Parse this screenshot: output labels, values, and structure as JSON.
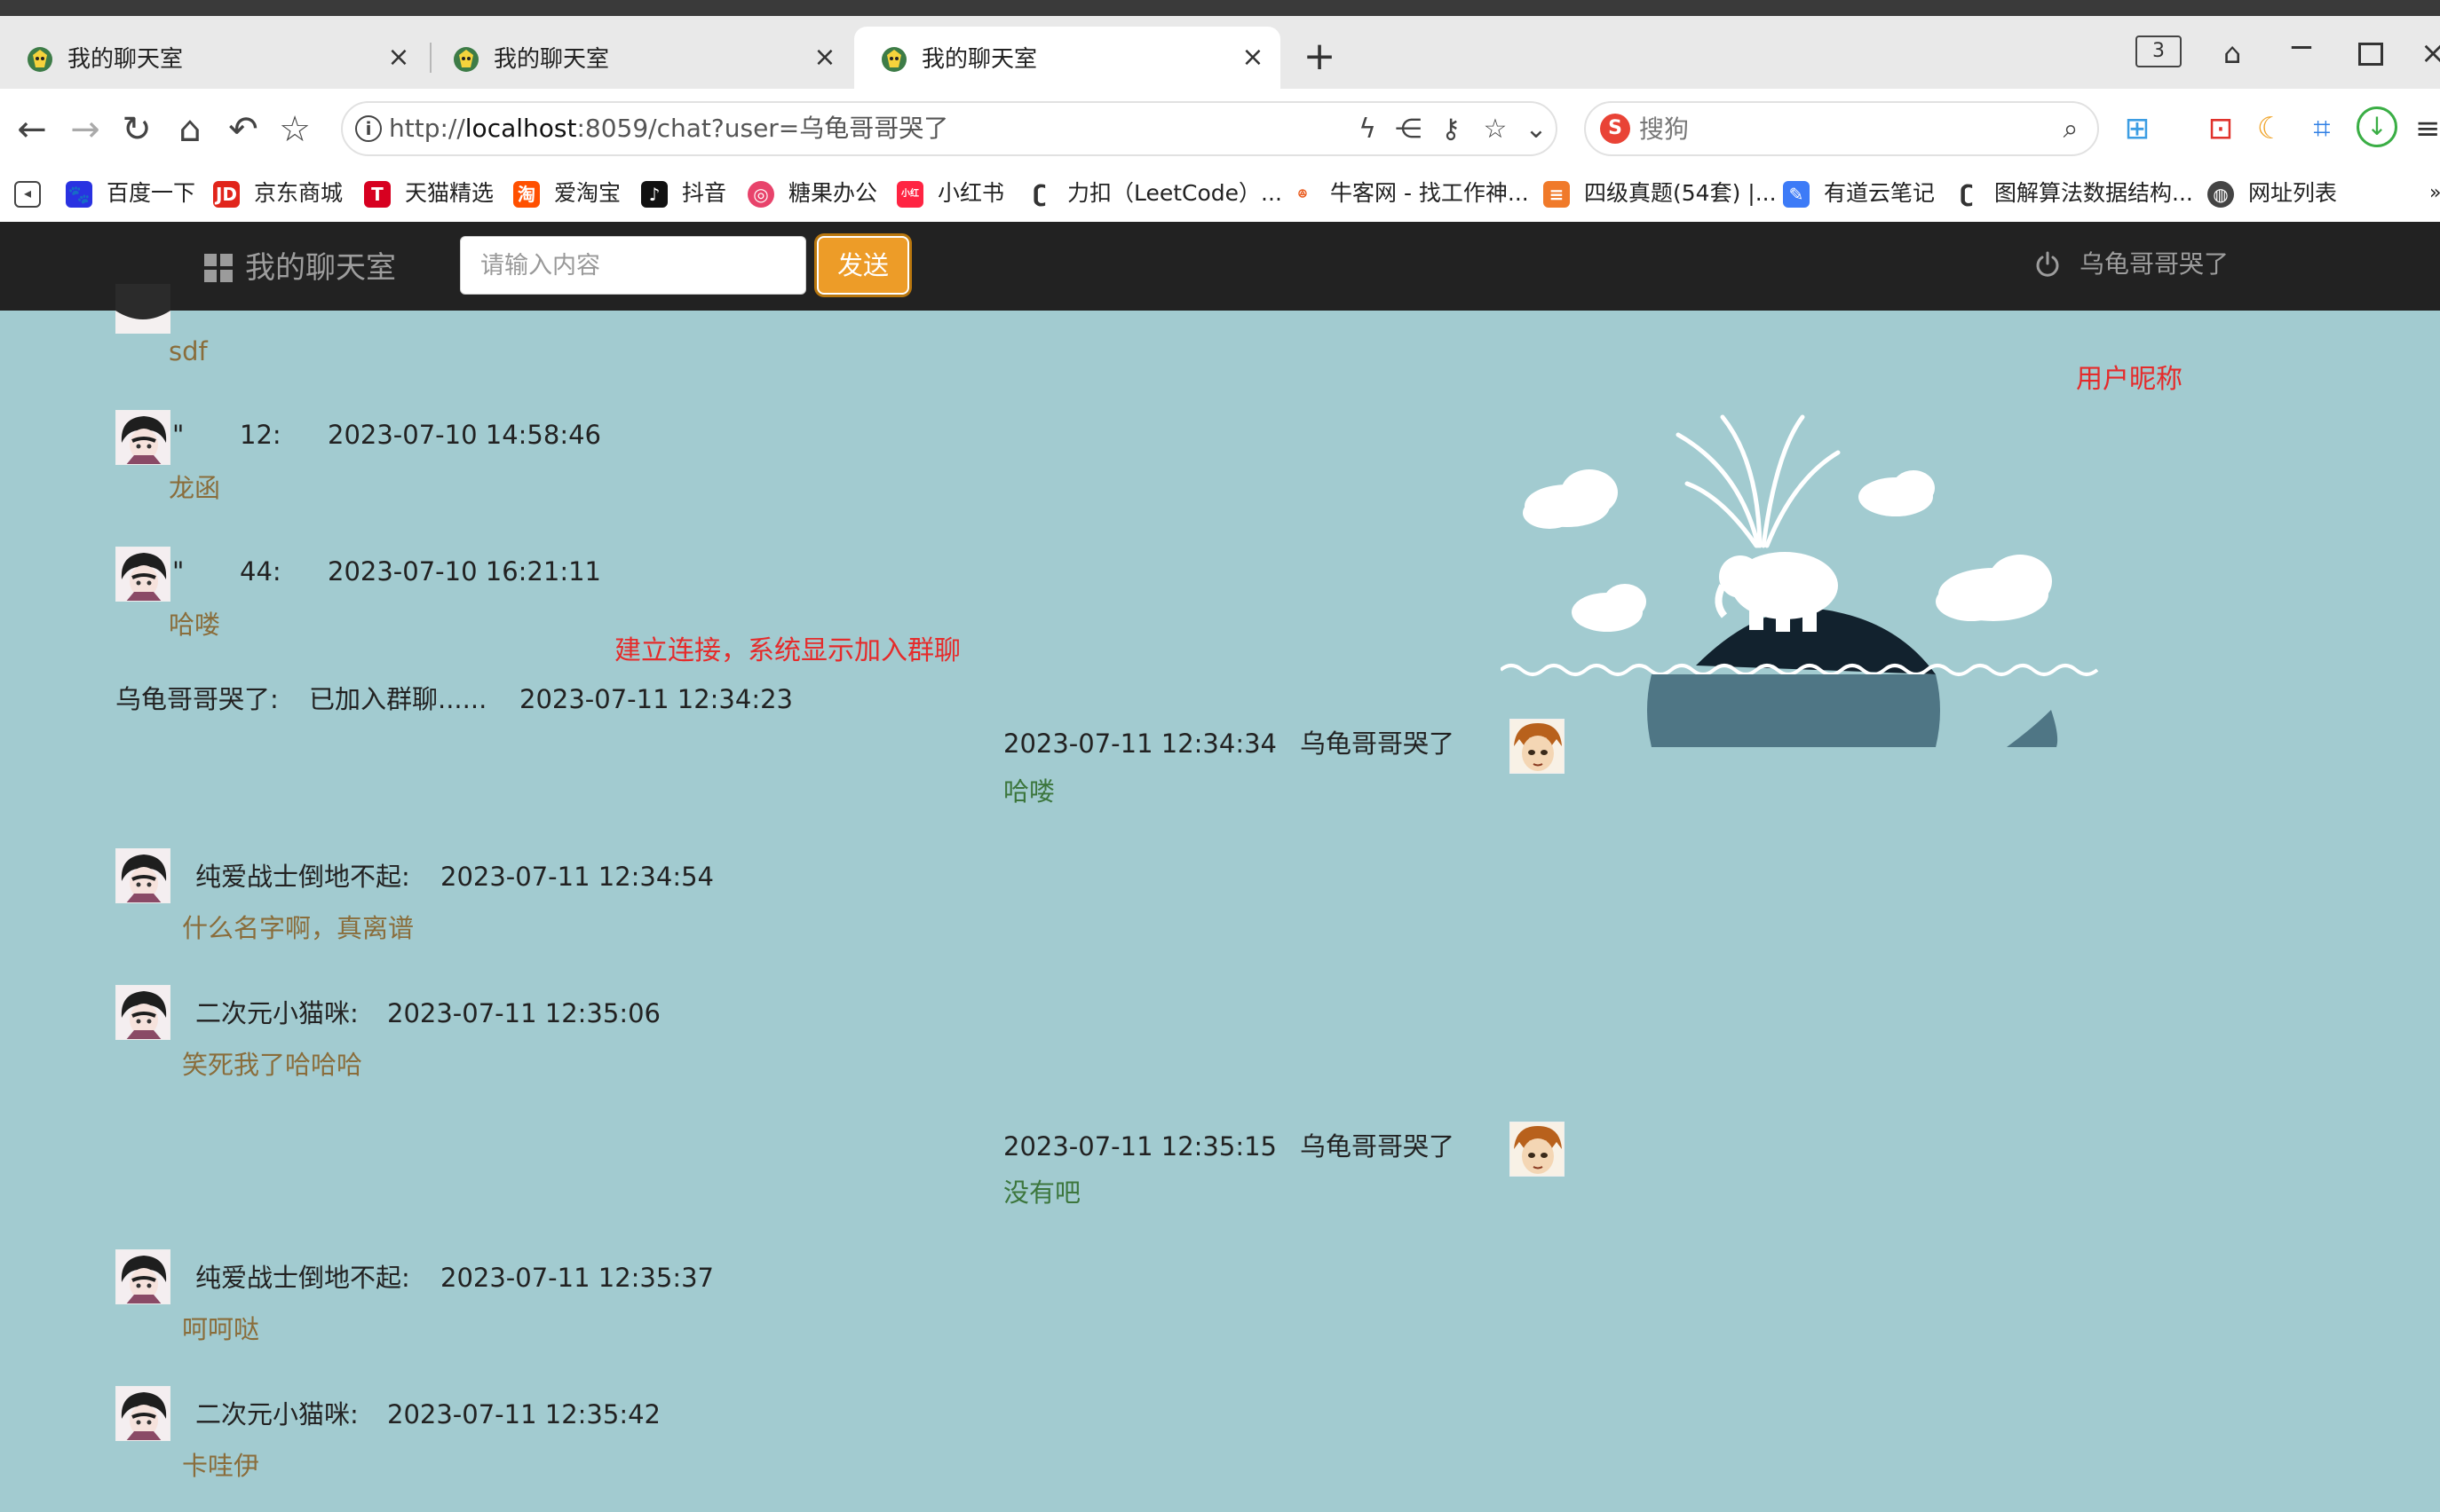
{
  "browser": {
    "tabs": [
      {
        "title": "我的聊天室"
      },
      {
        "title": "我的聊天室"
      },
      {
        "title": "我的聊天室"
      }
    ],
    "tab_count": "3",
    "url_prefix": "http://",
    "url_host": "localhost",
    "url_rest": ":8059/chat?user=乌龟哥哥哭了",
    "search_placeholder": "搜狗",
    "bookmarks": [
      {
        "label": "百度一下",
        "icon": "baidu-icon",
        "color": "#2932e1"
      },
      {
        "label": "京东商城",
        "icon": "jd-icon",
        "color": "#e1251b"
      },
      {
        "label": "天猫精选",
        "icon": "tmall-icon",
        "color": "#d70020"
      },
      {
        "label": "爱淘宝",
        "icon": "taobao-icon",
        "color": "#ff5000"
      },
      {
        "label": "抖音",
        "icon": "douyin-icon",
        "color": "#111111"
      },
      {
        "label": "糖果办公",
        "icon": "tangguo-icon",
        "color": "#e8436b"
      },
      {
        "label": "小红书",
        "icon": "xiaohongshu-icon",
        "color": "#ff2442"
      },
      {
        "label": "力扣（LeetCode）...",
        "icon": "leetcode-icon",
        "color": "#f89f1b"
      },
      {
        "label": "牛客网 - 找工作神...",
        "icon": "nowcoder-icon",
        "color": "#e95a1c"
      },
      {
        "label": "四级真题(54套) |...",
        "icon": "doc-icon",
        "color": "#f07a2a"
      },
      {
        "label": "有道云笔记",
        "icon": "youdao-icon",
        "color": "#3d7bf7"
      },
      {
        "label": "图解算法数据结构...",
        "icon": "leetcode-icon",
        "color": "#f89f1b"
      },
      {
        "label": "网址列表",
        "icon": "globe-icon",
        "color": "#444444"
      }
    ]
  },
  "app": {
    "brand": "我的聊天室",
    "input_placeholder": "请输入内容",
    "send_label": "发送",
    "current_user": "乌龟哥哥哭了"
  },
  "chat": {
    "partial_top": {
      "text": "sdf"
    },
    "entries": [
      {
        "who": "\"",
        "name_rest": "12:",
        "time": "2023-07-10 14:58:46",
        "text": "龙函"
      },
      {
        "who": "\"",
        "name_rest": "44:",
        "time": "2023-07-10 16:21:11",
        "text": "哈喽"
      }
    ],
    "system": {
      "name": "乌龟哥哥哭了:",
      "text": "已加入群聊......",
      "time": "2023-07-11 12:34:23"
    },
    "mine": [
      {
        "time": "2023-07-11 12:34:34",
        "name": "乌龟哥哥哭了",
        "text": "哈喽"
      },
      {
        "time": "2023-07-11 12:35:15",
        "name": "乌龟哥哥哭了",
        "text": "没有吧"
      }
    ],
    "others": [
      {
        "name": "纯爱战士倒地不起:",
        "time": "2023-07-11 12:34:54",
        "text": "什么名字啊，真离谱"
      },
      {
        "name": "二次元小猫咪:",
        "time": "2023-07-11 12:35:06",
        "text": "笑死我了哈哈哈"
      },
      {
        "name": "纯爱战士倒地不起:",
        "time": "2023-07-11 12:35:37",
        "text": "呵呵哒"
      },
      {
        "name": "二次元小猫咪:",
        "time": "2023-07-11 12:35:42",
        "text": "卡哇伊"
      }
    ]
  },
  "annotations": {
    "connect": "建立连接，系统显示加入群聊",
    "nickname": "用户昵称"
  },
  "colors": {
    "background": "#a2cbd0",
    "header": "#222222",
    "send_button": "#ed9c28",
    "other_message": "#8a6d3b",
    "own_message": "#3c763d",
    "annotation": "#e52b2b"
  }
}
